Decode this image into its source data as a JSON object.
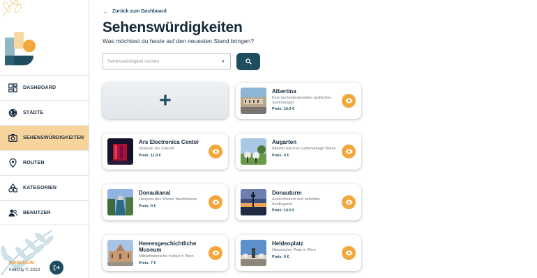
{
  "sidebar": {
    "items": [
      {
        "label": "DASHBOARD",
        "icon": "dashboard-icon"
      },
      {
        "label": "STÄDTE",
        "icon": "globe-icon"
      },
      {
        "label": "SEHENSWÜRDIGKEITEN",
        "icon": "camera-icon",
        "active": true
      },
      {
        "label": "ROUTEN",
        "icon": "map-pin-icon"
      },
      {
        "label": "KATEGORIEN",
        "icon": "shapes-icon"
      },
      {
        "label": "BENUTZER",
        "icon": "users-icon"
      }
    ],
    "impressum": "IMPRESSUM",
    "copyright": "FeliCity © 2022"
  },
  "header": {
    "back_label": "Zurück zum Dashboard",
    "title": "Sehenswürdigkeiten",
    "subtitle": "Was möchtest du heute auf den neuesten Stand bringen?"
  },
  "search": {
    "placeholder": "Sehenswürdigkeit suchen"
  },
  "add_label": "+",
  "sights": [
    {
      "name": "Albertina",
      "description": "Eine der bedeutendsten grafischen Sammlungen",
      "price": "Preis: 16.9 €"
    },
    {
      "name": "Ars Electronica Center",
      "description": "Museum der Zukunft",
      "price": "Preis: 11.9 €"
    },
    {
      "name": "Augarten",
      "description": "Ältester barocke Gartenanlage Wiens",
      "price": "Preis: 0 €"
    },
    {
      "name": "Donaukanal",
      "description": "Hotspots des Wiener Nachtlebens",
      "price": "Preis: 0 €"
    },
    {
      "name": "Donauturm",
      "description": "Aussichtsturm und beliebtes Ausflugsziel",
      "price": "Preis: 14.5 €"
    },
    {
      "name": "Heeresgeschichtliche Museum",
      "description": "Militärhistorische Institut in Wien",
      "price": "Preis: 7 €"
    },
    {
      "name": "Heldenplatz",
      "description": "Historischer Platz in Wien",
      "price": "Preis: 0 €"
    }
  ],
  "colors": {
    "primary": "#1e4d60",
    "accent": "#f3a73a",
    "active_nav": "#f7d49b"
  }
}
